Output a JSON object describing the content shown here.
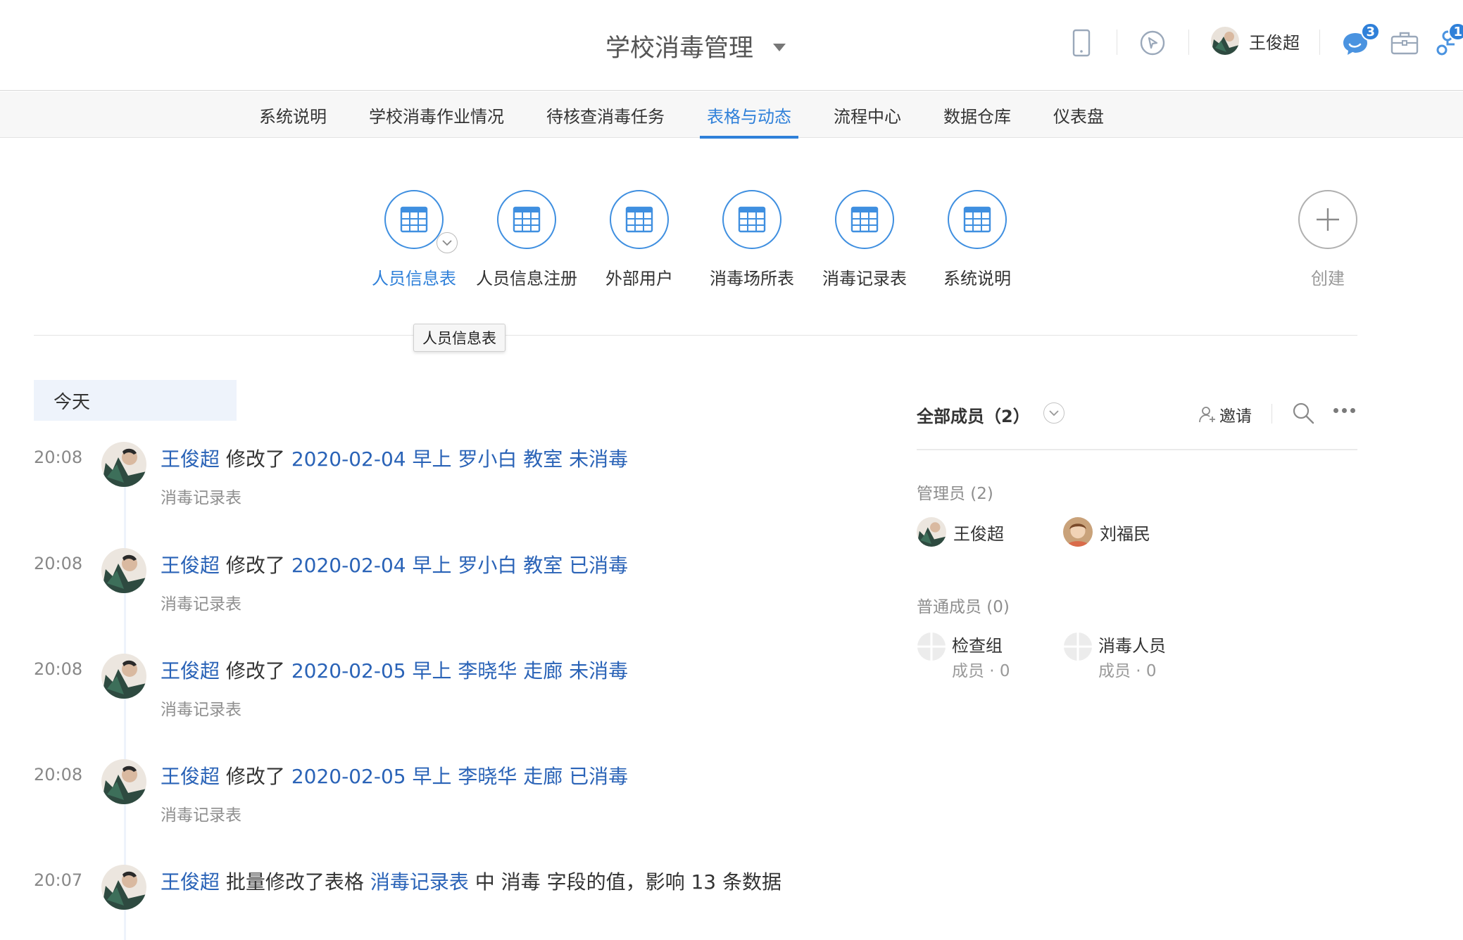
{
  "header": {
    "app_title": "学校消毒管理",
    "user_name": "王俊超",
    "notification_count": "3",
    "flow_count": "1",
    "icons": [
      "mobile-icon",
      "compass-icon",
      "chat-icon",
      "briefcase-icon",
      "flow-icon"
    ]
  },
  "nav": {
    "tabs": [
      {
        "label": "系统说明"
      },
      {
        "label": "学校消毒作业情况"
      },
      {
        "label": "待核查消毒任务"
      },
      {
        "label": "表格与动态"
      },
      {
        "label": "流程中心"
      },
      {
        "label": "数据仓库"
      },
      {
        "label": "仪表盘"
      }
    ],
    "active_tab": "表格与动态"
  },
  "forms": {
    "items": [
      {
        "label": "人员信息表"
      },
      {
        "label": "人员信息注册"
      },
      {
        "label": "外部用户"
      },
      {
        "label": "消毒场所表"
      },
      {
        "label": "消毒记录表"
      },
      {
        "label": "系统说明"
      }
    ],
    "create_label": "创建",
    "tooltip": "人员信息表"
  },
  "feed": {
    "date_label": "今天",
    "items": [
      {
        "time": "20:08",
        "user": "王俊超",
        "action": "修改了",
        "record": "2020-02-04 早上 罗小白 教室 未消毒",
        "source": "消毒记录表"
      },
      {
        "time": "20:08",
        "user": "王俊超",
        "action": "修改了",
        "record": "2020-02-04 早上 罗小白 教室 已消毒",
        "source": "消毒记录表"
      },
      {
        "time": "20:08",
        "user": "王俊超",
        "action": "修改了",
        "record": "2020-02-05 早上 李晓华 走廊 未消毒",
        "source": "消毒记录表"
      },
      {
        "time": "20:08",
        "user": "王俊超",
        "action": "修改了",
        "record": "2020-02-05 早上 李晓华 走廊 已消毒",
        "source": "消毒记录表"
      }
    ],
    "batch_item": {
      "time": "20:07",
      "user": "王俊超",
      "action": "批量修改了表格",
      "table": "消毒记录表",
      "rest": "中 消毒 字段的值，影响 13 条数据"
    }
  },
  "members": {
    "title": "全部成员（2）",
    "invite_label": "邀请",
    "admins_label": "管理员 (2)",
    "admins": [
      {
        "name": "王俊超"
      },
      {
        "name": "刘福民"
      }
    ],
    "regular_label": "普通成员 (0)",
    "roles": [
      {
        "name": "检查组",
        "count": "成员 · 0"
      },
      {
        "name": "消毒人员",
        "count": "成员 · 0"
      }
    ]
  }
}
